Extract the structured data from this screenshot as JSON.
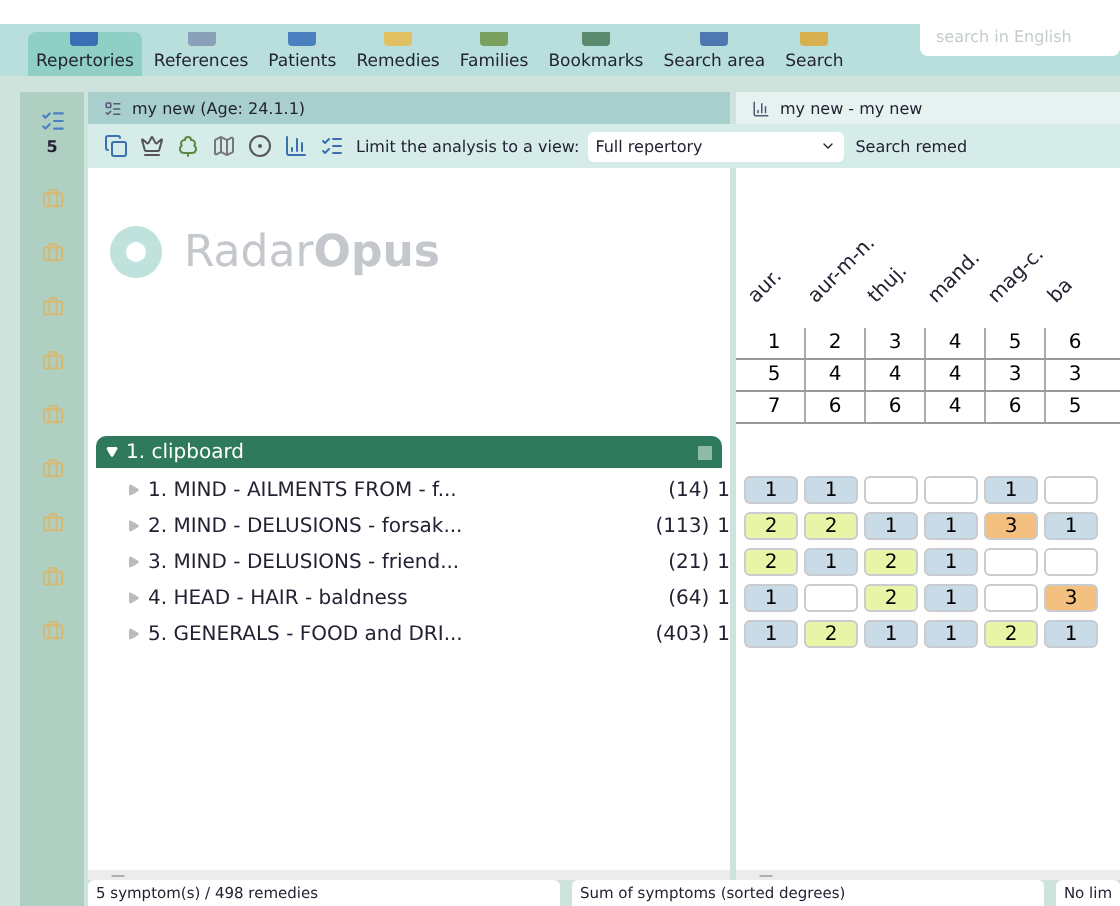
{
  "nav": [
    {
      "label": "Repertories",
      "selected": true,
      "color": "#3b6fb6"
    },
    {
      "label": "References",
      "selected": false,
      "color": "#8aa0b8"
    },
    {
      "label": "Patients",
      "selected": false,
      "color": "#4a7fc0"
    },
    {
      "label": "Remedies",
      "selected": false,
      "color": "#e0c060"
    },
    {
      "label": "Families",
      "selected": false,
      "color": "#7aa060"
    },
    {
      "label": "Bookmarks",
      "selected": false,
      "color": "#5a8a70"
    },
    {
      "label": "Search area",
      "selected": false,
      "color": "#5078b0"
    },
    {
      "label": "Search",
      "selected": false,
      "color": "#d8b050"
    }
  ],
  "search": {
    "placeholder": "search in English"
  },
  "sidebar": {
    "count": "5"
  },
  "left_panel": {
    "title": "my new (Age: 24.1.1)",
    "limit_label": "Limit the analysis to a view:",
    "view": "Full repertory",
    "logo": {
      "light": "Radar",
      "bold": "Opus"
    }
  },
  "right_panel": {
    "title": "my new - my new",
    "search_label": "Search remed"
  },
  "clipboard": {
    "title": "1. clipboard",
    "expanded": true
  },
  "remedies": [
    {
      "name": "aur.",
      "ranks": [
        "1",
        "5",
        "7"
      ]
    },
    {
      "name": "aur-m-n.",
      "ranks": [
        "2",
        "4",
        "6"
      ]
    },
    {
      "name": "thuj.",
      "ranks": [
        "3",
        "4",
        "6"
      ]
    },
    {
      "name": "mand.",
      "ranks": [
        "4",
        "4",
        "4"
      ]
    },
    {
      "name": "mag-c.",
      "ranks": [
        "5",
        "3",
        "6"
      ]
    },
    {
      "name": "ba",
      "ranks": [
        "6",
        "3",
        "5"
      ]
    }
  ],
  "symptoms": [
    {
      "label": "1. MIND - AILMENTS FROM - f...",
      "count": "(14)",
      "weight": "1",
      "grades": [
        {
          "kind": "grade",
          "value": "1"
        },
        {
          "kind": "grade",
          "value": "1"
        },
        {
          "kind": "empty"
        },
        {
          "kind": "empty"
        },
        {
          "kind": "grade",
          "value": "1"
        },
        {
          "kind": "empty"
        }
      ]
    },
    {
      "label": "2. MIND - DELUSIONS - forsak...",
      "count": "(113)",
      "weight": "1",
      "grades": [
        {
          "kind": "grade",
          "value": "2"
        },
        {
          "kind": "grade",
          "value": "2"
        },
        {
          "kind": "grade",
          "value": "1"
        },
        {
          "kind": "grade",
          "value": "1"
        },
        {
          "kind": "grade",
          "value": "3"
        },
        {
          "kind": "grade",
          "value": "1"
        }
      ]
    },
    {
      "label": "3. MIND - DELUSIONS - friend...",
      "count": "(21)",
      "weight": "1",
      "grades": [
        {
          "kind": "grade",
          "value": "2"
        },
        {
          "kind": "grade",
          "value": "1"
        },
        {
          "kind": "grade",
          "value": "2"
        },
        {
          "kind": "grade",
          "value": "1"
        },
        {
          "kind": "empty"
        },
        {
          "kind": "empty"
        }
      ]
    },
    {
      "label": "4. HEAD - HAIR - baldness",
      "count": "(64)",
      "weight": "1",
      "grades": [
        {
          "kind": "grade",
          "value": "1"
        },
        {
          "kind": "empty"
        },
        {
          "kind": "grade",
          "value": "2"
        },
        {
          "kind": "grade",
          "value": "1"
        },
        {
          "kind": "empty"
        },
        {
          "kind": "grade",
          "value": "3"
        }
      ]
    },
    {
      "label": "5. GENERALS - FOOD and DRI...",
      "count": "(403)",
      "weight": "1",
      "grades": [
        {
          "kind": "grade",
          "value": "1"
        },
        {
          "kind": "grade",
          "value": "2"
        },
        {
          "kind": "grade",
          "value": "1"
        },
        {
          "kind": "grade",
          "value": "1"
        },
        {
          "kind": "grade",
          "value": "2"
        },
        {
          "kind": "grade",
          "value": "1"
        }
      ]
    }
  ],
  "status_bar": [
    "5 symptom(s) / 498 remedies",
    "Sum of symptoms (sorted degrees)",
    "No lim"
  ]
}
